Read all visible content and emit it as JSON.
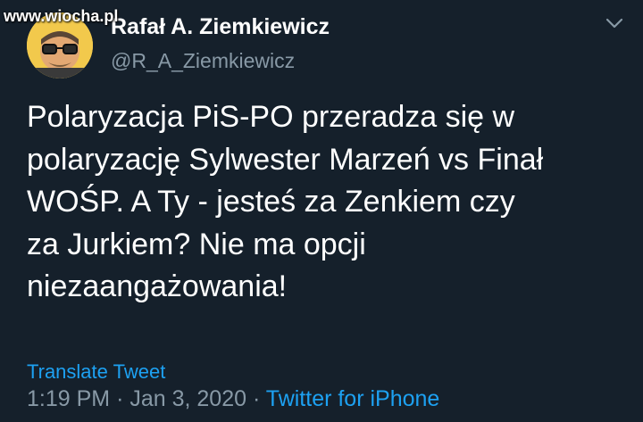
{
  "watermark": "www.wiocha.pl",
  "author": {
    "display_name": "Rafał A. Ziemkiewicz",
    "handle": "@R_A_Ziemkiewicz"
  },
  "tweet": {
    "text_lines": [
      "Polaryzacja PiS-PO przeradza się w",
      "polaryzację Sylwester Marzeń vs Finał",
      "WOŚP. A Ty - jesteś za Zenkiem czy",
      "za Jurkiem? Nie ma opcji",
      "niezaangażowania!"
    ],
    "translate_label": "Translate Tweet",
    "time": "1:19 PM",
    "separator": "·",
    "date": "Jan 3, 2020",
    "source": "Twitter for iPhone"
  },
  "icons": {
    "menu": "chevron-down-icon"
  },
  "colors": {
    "background": "#15202b",
    "text": "#ffffff",
    "secondary": "#8899a6",
    "link": "#1da1f2"
  }
}
